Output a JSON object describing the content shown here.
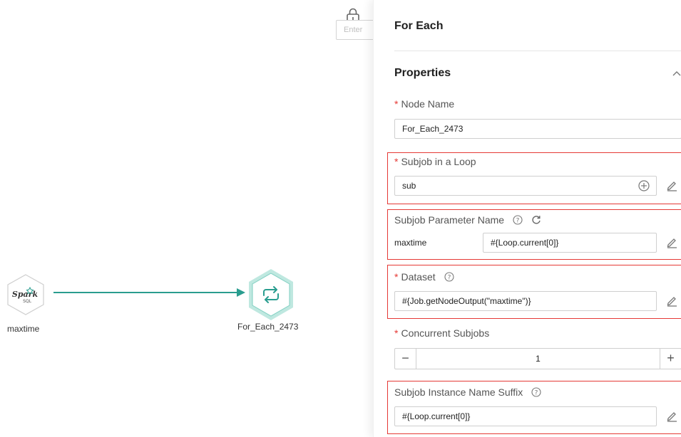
{
  "canvas": {
    "search_placeholder": "Enter",
    "nodes": [
      {
        "label": "maxtime",
        "type": "Spark SQL",
        "logo_text": "Spark",
        "logo_sub": "SQL"
      },
      {
        "label": "For_Each_2473",
        "type": "For Each"
      }
    ],
    "colors": {
      "edge": "#2a9d8f",
      "loop_ring": "#bfe8e0",
      "loop_fill": "#ffffff"
    }
  },
  "panel": {
    "title": "For Each",
    "section_title": "Properties",
    "fields": {
      "node_name": {
        "label": "Node Name",
        "required": true,
        "value": "For_Each_2473"
      },
      "subjob_loop": {
        "label": "Subjob in a Loop",
        "required": true,
        "value": "sub"
      },
      "subjob_param": {
        "label": "Subjob Parameter Name",
        "param_name": "maxtime",
        "value": "#{Loop.current[0]}"
      },
      "dataset": {
        "label": "Dataset",
        "required": true,
        "value": "#{Job.getNodeOutput(\"maxtime\")}"
      },
      "concurrent": {
        "label": "Concurrent Subjobs",
        "required": true,
        "value": "1",
        "minus": "−",
        "plus": "+"
      },
      "instance_suffix": {
        "label": "Subjob Instance Name Suffix",
        "value": "#{Loop.current[0]}"
      }
    },
    "colors": {
      "required": "#e53935",
      "highlight": "#e53935"
    }
  }
}
